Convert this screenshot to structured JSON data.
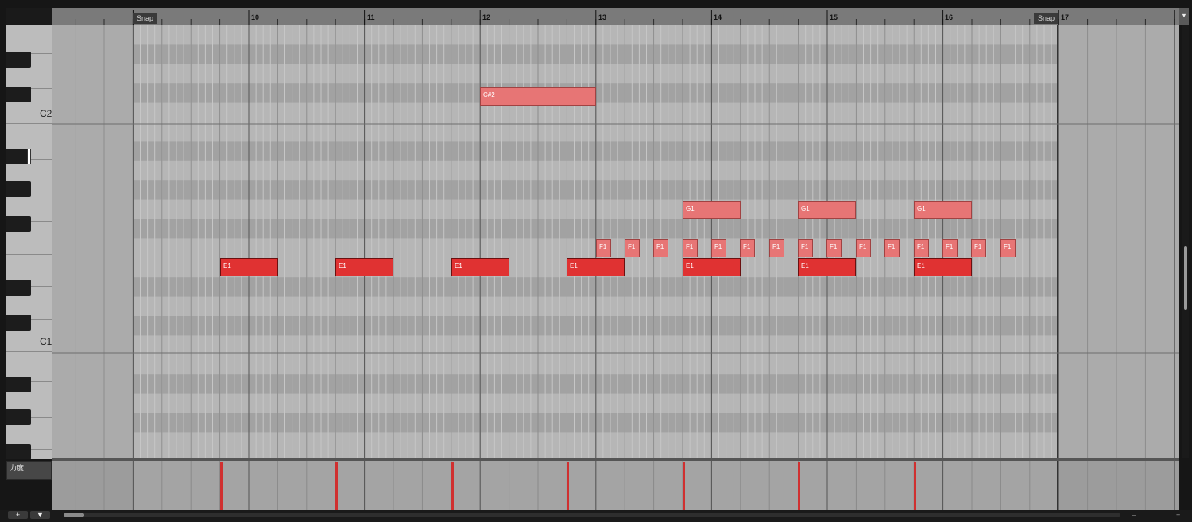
{
  "ruler": {
    "bars": [
      "10",
      "11",
      "12",
      "13",
      "14",
      "15",
      "16",
      "17"
    ],
    "snap_left": "Snap",
    "snap_right": "Snap"
  },
  "keyboard": {
    "c2_label": "C2",
    "c1_label": "C1"
  },
  "notes": {
    "cs2": "C#2",
    "g1": "G1",
    "f1": "F1",
    "e1": "E1"
  },
  "velocity": {
    "lane_label": "力度"
  },
  "toolbar": {
    "add_label": "+",
    "menu_label": "▼",
    "corner_label": "▼",
    "zoom_minus": "–",
    "zoom_plus": "+"
  }
}
